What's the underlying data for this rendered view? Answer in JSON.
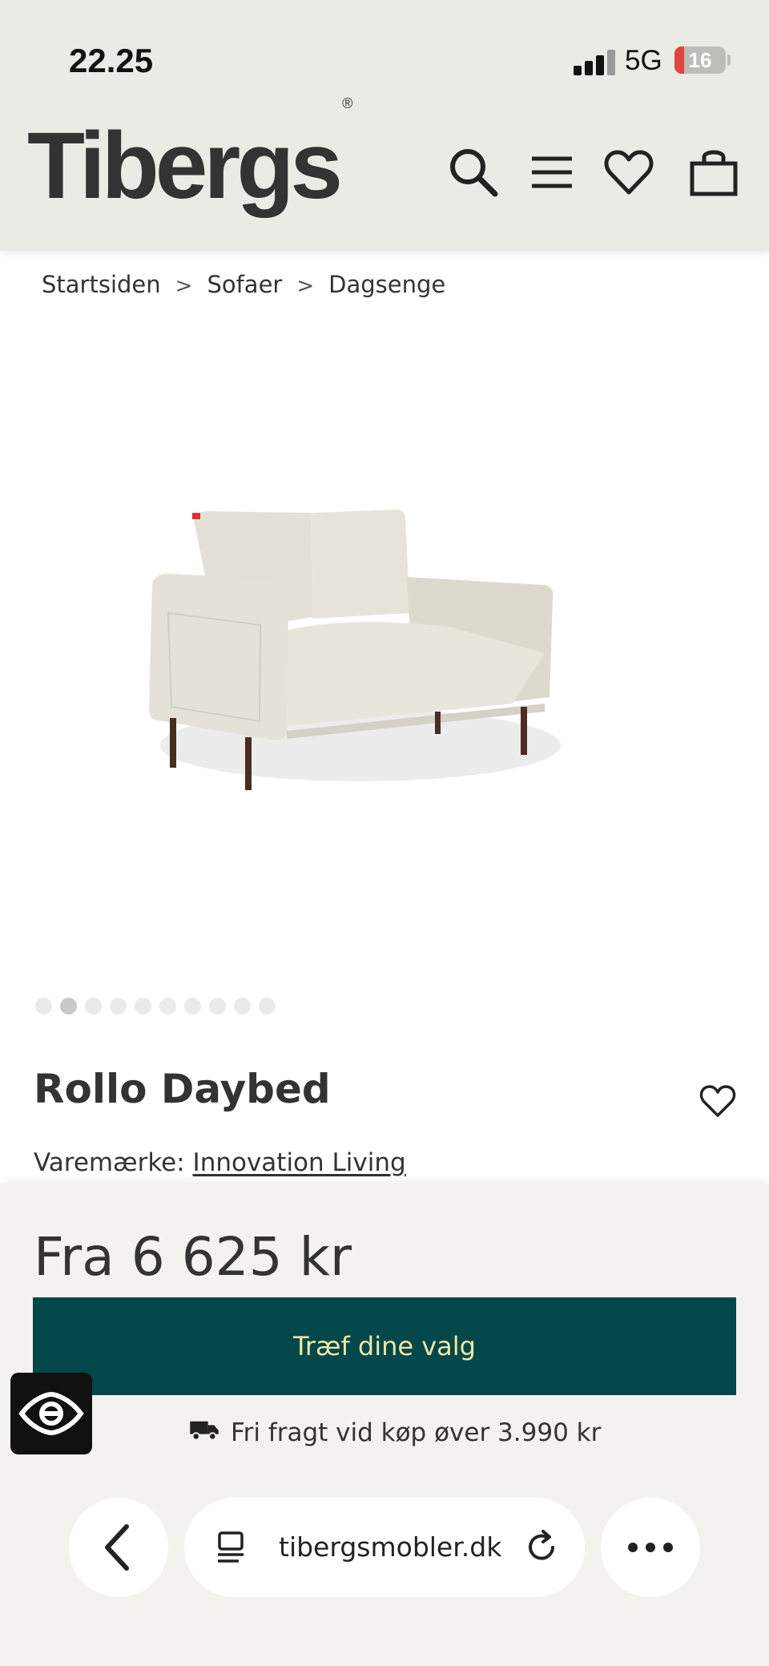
{
  "status_bar": {
    "time": "22.25",
    "network": "5G",
    "battery": "16"
  },
  "header": {
    "logo": "Tibergs",
    "logo_mark": "®",
    "icons": [
      "search-icon",
      "menu-icon",
      "heart-icon",
      "bag-icon"
    ]
  },
  "breadcrumb": [
    "Startsiden",
    "Sofaer",
    "Dagsenge"
  ],
  "breadcrumb_separator": ">",
  "gallery": {
    "total_images": 10,
    "active_index": 1
  },
  "product": {
    "title": "Rollo Daybed",
    "brand_label": "Varemærke:",
    "brand_name": "Innovation Living"
  },
  "purchase": {
    "price": "Fra 6 625 kr",
    "cta_label": "Træf dine valg",
    "shipping_text": "Fri fragt vid køp øver 3.990 kr"
  },
  "browser": {
    "url": "tibergsmobler.dk"
  },
  "colors": {
    "header_bg": "#ebebe5",
    "cta_bg": "#02474a",
    "cta_text": "#f0e7a6"
  }
}
